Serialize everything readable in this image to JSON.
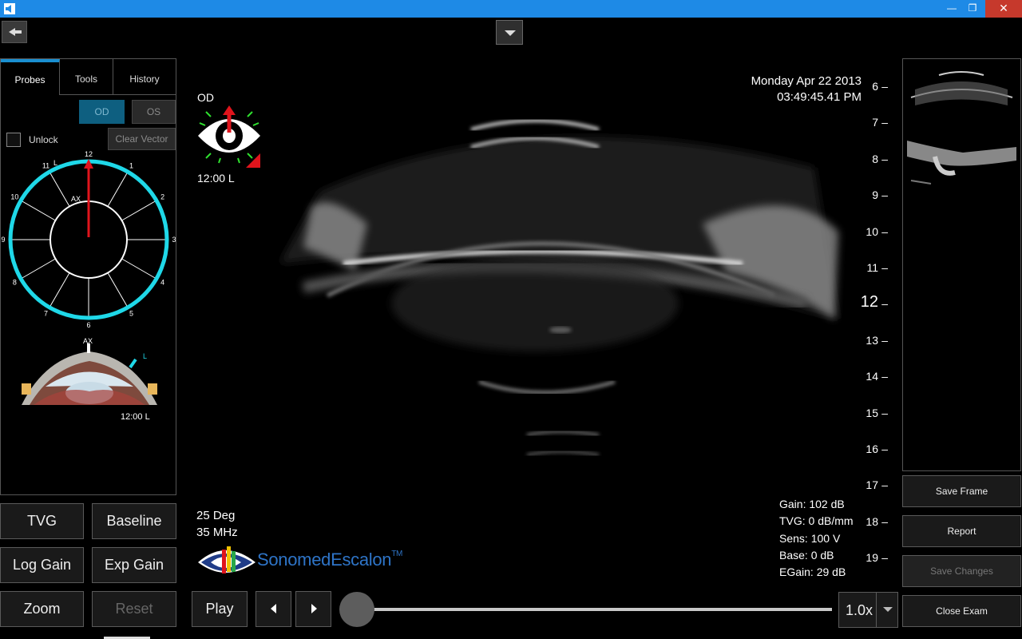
{
  "window": {
    "minimize": "—",
    "maximize": "❐",
    "close": "✕"
  },
  "tabs": [
    {
      "label": "Probes"
    },
    {
      "label": "Tools"
    },
    {
      "label": "History"
    }
  ],
  "probes": {
    "od": "OD",
    "os": "OS",
    "unlock": "Unlock",
    "clear_vector": "Clear Vector",
    "clock_numbers": [
      "12",
      "1",
      "2",
      "3",
      "4",
      "5",
      "6",
      "7",
      "8",
      "9",
      "10",
      "11"
    ],
    "clock_l": "L",
    "clock_ax": "AX",
    "cross_ax": "AX",
    "cross_l": "L",
    "cross_time": "12:00 L"
  },
  "buttons": {
    "tvg": "TVG",
    "baseline": "Baseline",
    "log_gain": "Log Gain",
    "exp_gain": "Exp Gain",
    "zoom": "Zoom",
    "reset": "Reset"
  },
  "scan": {
    "eye": "OD",
    "position": "12:00 L",
    "date": "Monday Apr 22 2013",
    "time": "03:49:45.41 PM",
    "angle": "25 Deg",
    "frequency": "35 MHz",
    "readouts": {
      "gain": "Gain: 102 dB",
      "tvg": "TVG: 0 dB/mm",
      "sens": "Sens: 100 V",
      "base": "Base: 0 dB",
      "egain": "EGain: 29 dB"
    },
    "scale": [
      "6",
      "7",
      "8",
      "9",
      "10",
      "11",
      "12",
      "13",
      "14",
      "15",
      "16",
      "17",
      "18",
      "19"
    ],
    "scale_dash": "–"
  },
  "logo": {
    "name": "SonomedEscalon",
    "tm": "TM"
  },
  "right": {
    "save_frame": "Save Frame",
    "report": "Report",
    "save_changes": "Save Changes",
    "close_exam": "Close Exam"
  },
  "playback": {
    "play": "Play",
    "speed": "1.0x",
    "position": 0.0
  },
  "colors": {
    "accent": "#1a8fd0",
    "ring": "#1fd8e8",
    "vector": "#e0141c",
    "titlebar": "#1e8ae6"
  }
}
